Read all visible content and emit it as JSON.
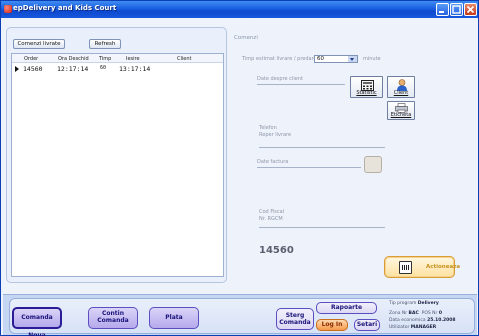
{
  "window": {
    "title": "epDelivery and Kids Court"
  },
  "orders_panel": {
    "btn_orders": "Comenzi livrate",
    "btn_refresh": "Refresh",
    "columns": [
      "Order",
      "Ora Deschid",
      "Timp",
      "Iesire",
      "Client"
    ],
    "rows": [
      {
        "order": "14560",
        "open": "12:17:14",
        "time": "60",
        "exit": "13:17:14",
        "client": ""
      }
    ]
  },
  "order_panel": {
    "section_title": "Comenzi",
    "delivery_label": "Timp estimat livrare / predare",
    "delivery_value": "60",
    "delivery_unit": "minute",
    "client_section": "Date despre client",
    "statistic_label": "Statistic",
    "client_label": "Client",
    "label_label": "Eticheta",
    "phone_label": "Telefon",
    "delivery_ref_label": "Reper livrare",
    "invoice_label": "Date factura",
    "fiscal_code_label": "Cod Fiscal",
    "reg_label": "Nr. RGCM",
    "order_number": "14560",
    "action_label": "Actioneaza"
  },
  "bottom_bar": {
    "btn_new": "Comanda Noua",
    "btn_continue_1": "Contin",
    "btn_continue_2": "Comanda",
    "btn_pay": "Plata",
    "btn_delete_1": "Sterg",
    "btn_delete_2": "Comanda",
    "btn_reports": "Rapoarte",
    "btn_login": "Log In",
    "btn_settings": "Setari",
    "program_type_label": "Tip program",
    "program_type_value": "Delivery",
    "zone_label": "Zona Nr",
    "zone_value": "BAC",
    "pos_label": "POS Nr",
    "pos_value": "0",
    "date_label": "Data economica",
    "date_value": "25.10.2008",
    "user_label": "Utilizator",
    "user_value": "MANAGER"
  },
  "colors": {
    "title_bar": "#1a5fe0",
    "accent": "#b5a9ec",
    "action": "#ffe1a0"
  }
}
